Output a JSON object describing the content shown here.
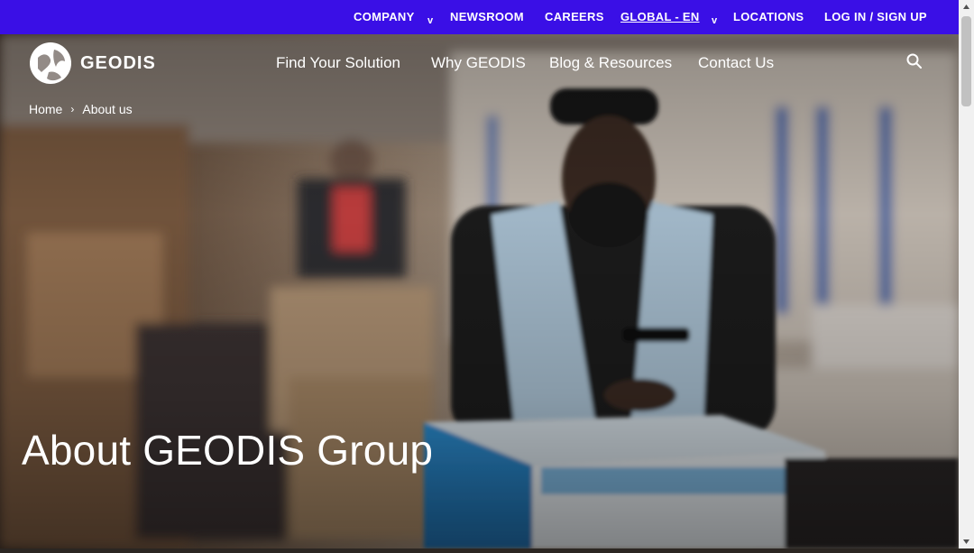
{
  "topbar": {
    "items": [
      {
        "label": "COMPANY",
        "has_dropdown": true
      },
      {
        "label": "NEWSROOM",
        "has_dropdown": false
      },
      {
        "label": "CAREERS",
        "has_dropdown": false
      },
      {
        "label": "GLOBAL - EN",
        "has_dropdown": true
      },
      {
        "label": "LOCATIONS",
        "has_dropdown": false
      },
      {
        "label": "LOG IN / SIGN UP",
        "has_dropdown": false
      }
    ],
    "caret": "v",
    "color": "#3a0fe6"
  },
  "header": {
    "logo_text": "GEODIS",
    "nav": [
      {
        "label": "Find Your Solution"
      },
      {
        "label": "Why GEODIS"
      },
      {
        "label": "Blog & Resources"
      },
      {
        "label": "Contact Us"
      }
    ],
    "search_icon": "search-icon"
  },
  "breadcrumb": {
    "items": [
      {
        "label": "Home"
      },
      {
        "label": "About us"
      }
    ],
    "separator": "›"
  },
  "hero": {
    "title": "About GEODIS Group"
  }
}
